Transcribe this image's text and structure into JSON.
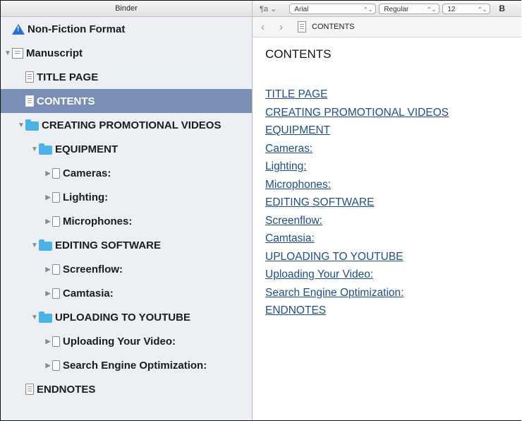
{
  "binder": {
    "header": "Binder",
    "items": [
      {
        "label": "Non-Fiction Format",
        "icon": "warning-icon",
        "indent": 0,
        "disclosure": "none",
        "selected": false
      },
      {
        "label": "Manuscript",
        "icon": "manuscript-icon",
        "indent": 0,
        "disclosure": "open",
        "selected": false
      },
      {
        "label": "TITLE PAGE",
        "icon": "document-icon",
        "indent": 1,
        "disclosure": "none",
        "selected": false
      },
      {
        "label": "CONTENTS",
        "icon": "document-icon",
        "indent": 1,
        "disclosure": "none",
        "selected": true
      },
      {
        "label": "CREATING PROMOTIONAL VIDEOS",
        "icon": "folder-icon",
        "indent": 1,
        "disclosure": "open",
        "selected": false
      },
      {
        "label": "EQUIPMENT",
        "icon": "folder-icon",
        "indent": 2,
        "disclosure": "open",
        "selected": false
      },
      {
        "label": "Cameras:",
        "icon": "page-icon",
        "indent": 3,
        "disclosure": "closed",
        "selected": false
      },
      {
        "label": "Lighting:",
        "icon": "page-icon",
        "indent": 3,
        "disclosure": "closed",
        "selected": false
      },
      {
        "label": "Microphones:",
        "icon": "page-icon",
        "indent": 3,
        "disclosure": "closed",
        "selected": false
      },
      {
        "label": "EDITING SOFTWARE",
        "icon": "folder-icon",
        "indent": 2,
        "disclosure": "open",
        "selected": false
      },
      {
        "label": "Screenflow:",
        "icon": "page-icon",
        "indent": 3,
        "disclosure": "closed",
        "selected": false
      },
      {
        "label": "Camtasia:",
        "icon": "page-icon",
        "indent": 3,
        "disclosure": "closed",
        "selected": false
      },
      {
        "label": "UPLOADING TO YOUTUBE",
        "icon": "folder-icon",
        "indent": 2,
        "disclosure": "open",
        "selected": false
      },
      {
        "label": "Uploading Your Video:",
        "icon": "page-icon",
        "indent": 3,
        "disclosure": "closed",
        "selected": false
      },
      {
        "label": "Search Engine Optimization:",
        "icon": "page-icon",
        "indent": 3,
        "disclosure": "closed",
        "selected": false
      },
      {
        "label": "ENDNOTES",
        "icon": "document-icon",
        "indent": 1,
        "disclosure": "none",
        "selected": false
      }
    ]
  },
  "format_bar": {
    "paragraph_style_icon": "paragraph-style-icon",
    "font": "Arial",
    "weight": "Regular",
    "size": "12",
    "bold": "B"
  },
  "nav_bar": {
    "back_icon": "chevron-left-icon",
    "forward_icon": "chevron-right-icon",
    "document_title": "CONTENTS"
  },
  "editor": {
    "heading": "CONTENTS",
    "toc": [
      "TITLE PAGE",
      "CREATING PROMOTIONAL VIDEOS",
      "EQUIPMENT",
      "Cameras:",
      "Lighting:",
      "Microphones:",
      "EDITING SOFTWARE",
      "Screenflow:",
      "Camtasia:",
      "UPLOADING TO YOUTUBE",
      "Uploading Your Video:",
      "Search Engine Optimization:",
      "ENDNOTES"
    ]
  },
  "colors": {
    "selection": "#7b8fb6",
    "link": "#1f4e8c",
    "folder": "#4cb1e7",
    "warning": "#2a6fd3"
  }
}
